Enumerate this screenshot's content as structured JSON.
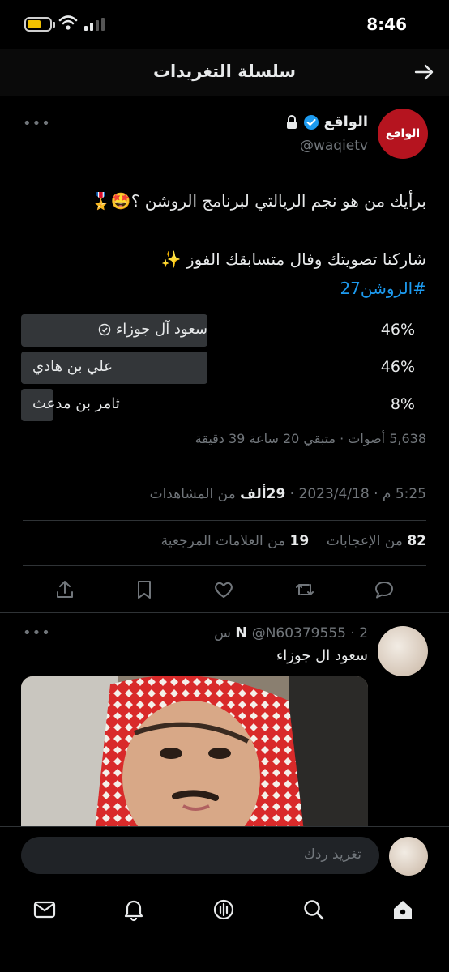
{
  "status_bar": {
    "time": "8:46"
  },
  "header": {
    "title": "سلسلة التغريدات"
  },
  "tweet": {
    "avatar_text": "الواقع",
    "display_name": "الواقع",
    "handle": "@waqietv",
    "text_line1": "برأيك من هو نجم الريالتي لبرنامج الروشن ؟🤩🎖️",
    "text_line2": "شاركنا تصويتك وفال متسابقك الفوز ✨",
    "hashtag": "#الروشن27",
    "poll": {
      "options": [
        {
          "label": "سعود آل جوزاء",
          "percent": "46%",
          "value": 46,
          "selected": true
        },
        {
          "label": "علي بن هادي",
          "percent": "46%",
          "value": 46,
          "selected": false
        },
        {
          "label": "ثامر بن مدعث",
          "percent": "8%",
          "value": 8,
          "selected": false
        }
      ],
      "meta": "5,638 أصوات · متبقي 20 ساعة 39 دقيقة"
    },
    "timestamp": "5:25 م · 2023/4/18 · ",
    "views_count": "29",
    "views_unit": "ألف",
    "views_label": "من المشاهدات",
    "retweets_count": "82",
    "retweets_label": "من الإعجابات",
    "bookmarks_count": "19",
    "bookmarks_label": "من العلامات المرجعية"
  },
  "reply": {
    "name": "N",
    "handle": "@N60379555",
    "time": "2 س",
    "text": "سعود ال جوزاء"
  },
  "composer": {
    "placeholder": "تغريد ردك"
  },
  "colors": {
    "accent": "#1d9bf0",
    "brand_red": "#b5141f",
    "bar": "#333639"
  }
}
